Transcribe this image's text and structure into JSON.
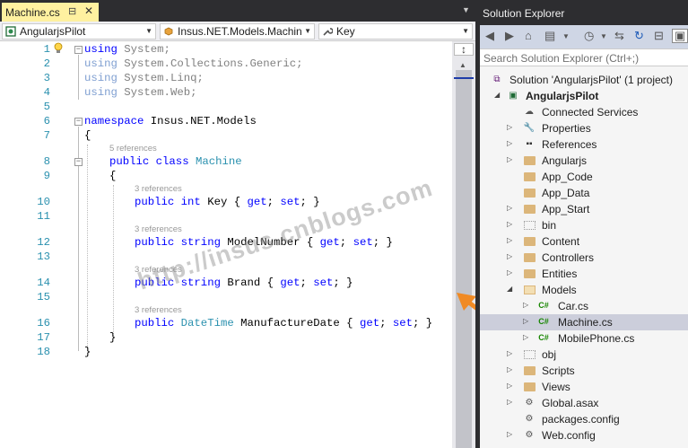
{
  "editor": {
    "tab_title": "Machine.cs",
    "nav_project": "AngularjsPilot",
    "nav_class": "Insus.NET.Models.Machin",
    "nav_member": "Key",
    "lines": [
      {
        "n": "1",
        "text": "using System;"
      },
      {
        "n": "2",
        "text": "using System.Collections.Generic;"
      },
      {
        "n": "3",
        "text": "using System.Linq;"
      },
      {
        "n": "4",
        "text": "using System.Web;"
      },
      {
        "n": "5",
        "text": ""
      },
      {
        "n": "6",
        "text": "namespace Insus.NET.Models"
      },
      {
        "n": "7",
        "text": "{"
      },
      {
        "n": "8",
        "text": "public class Machine"
      },
      {
        "n": "9",
        "text": "{"
      },
      {
        "n": "10",
        "text": "public int Key { get; set; }"
      },
      {
        "n": "11",
        "text": ""
      },
      {
        "n": "12",
        "text": "public string ModelNumber { get; set; }"
      },
      {
        "n": "13",
        "text": ""
      },
      {
        "n": "14",
        "text": "public string Brand { get; set; }"
      },
      {
        "n": "15",
        "text": ""
      },
      {
        "n": "16",
        "text": "public DateTime ManufactureDate { get; set; }"
      },
      {
        "n": "17",
        "text": "}"
      },
      {
        "n": "18",
        "text": "}"
      }
    ],
    "refs_class": "5 references",
    "refs_member": "3 references"
  },
  "watermark": "http://insus.cnblogs.com",
  "solution_explorer": {
    "title": "Solution Explorer",
    "search_placeholder": "Search Solution Explorer (Ctrl+;)",
    "items": [
      {
        "label": "Solution 'AngularjsPilot' (1 project)",
        "icon": "solution-icon"
      },
      {
        "label": "AngularjsPilot",
        "icon": "web-project-icon"
      },
      {
        "label": "Connected Services",
        "icon": "connected-services-icon"
      },
      {
        "label": "Properties",
        "icon": "wrench-icon"
      },
      {
        "label": "References",
        "icon": "references-icon"
      },
      {
        "label": "Angularjs",
        "icon": "folder-icon"
      },
      {
        "label": "App_Code",
        "icon": "folder-icon"
      },
      {
        "label": "App_Data",
        "icon": "folder-icon"
      },
      {
        "label": "App_Start",
        "icon": "folder-icon"
      },
      {
        "label": "bin",
        "icon": "dotted-folder-icon"
      },
      {
        "label": "Content",
        "icon": "folder-icon"
      },
      {
        "label": "Controllers",
        "icon": "folder-icon"
      },
      {
        "label": "Entities",
        "icon": "folder-icon"
      },
      {
        "label": "Models",
        "icon": "open-folder-icon"
      },
      {
        "label": "Car.cs",
        "icon": "csharp-file-icon"
      },
      {
        "label": "Machine.cs",
        "icon": "csharp-file-icon"
      },
      {
        "label": "MobilePhone.cs",
        "icon": "csharp-file-icon"
      },
      {
        "label": "obj",
        "icon": "dotted-folder-icon"
      },
      {
        "label": "Scripts",
        "icon": "folder-icon"
      },
      {
        "label": "Views",
        "icon": "folder-icon"
      },
      {
        "label": "Global.asax",
        "icon": "asax-file-icon"
      },
      {
        "label": "packages.config",
        "icon": "config-file-icon"
      },
      {
        "label": "Web.config",
        "icon": "config-file-icon"
      }
    ]
  },
  "colors": {
    "accent": "#007acc",
    "keyword": "#0000ff",
    "type": "#2b91af",
    "tab_active": "#fff1a0",
    "selection": "#cccedb",
    "annotation_arrow": "#f08a24"
  }
}
